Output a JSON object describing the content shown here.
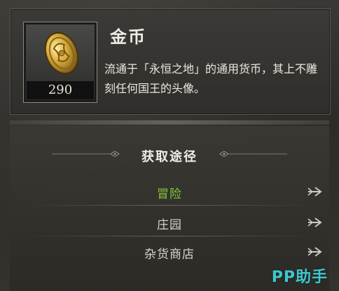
{
  "item": {
    "name": "金币",
    "description": "流通于「永恒之地」的通用货币，其上不雕刻任何国王的头像。",
    "count": "290"
  },
  "acquisition": {
    "title": "获取途径",
    "sources": [
      {
        "label": "冒险",
        "highlighted": true
      },
      {
        "label": "庄园",
        "highlighted": false
      },
      {
        "label": "杂货商店",
        "highlighted": false
      }
    ]
  },
  "colors": {
    "highlight": "#7ec93f",
    "normal_text": "#d9d5cc",
    "watermark": "#3ec7cf"
  },
  "watermark": "PP助手"
}
